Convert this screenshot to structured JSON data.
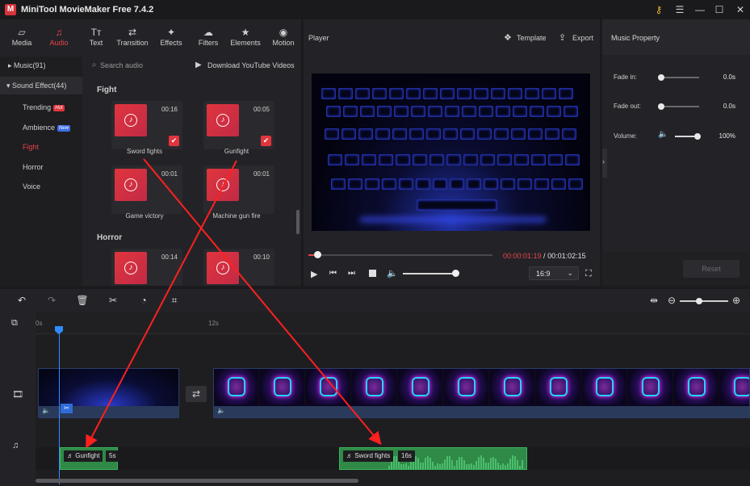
{
  "app": {
    "title": "MiniTool MovieMaker Free 7.4.2",
    "logo_text": "M"
  },
  "window_controls": {
    "key": "⚷",
    "menu": "☰",
    "minimize": "—",
    "maximize": "☐",
    "close": "✕"
  },
  "tabs": [
    {
      "label": "Media",
      "icon": "▱"
    },
    {
      "label": "Audio",
      "icon": "♫"
    },
    {
      "label": "Text",
      "icon": "Tт"
    },
    {
      "label": "Transition",
      "icon": "⇄"
    },
    {
      "label": "Effects",
      "icon": "✦"
    },
    {
      "label": "Filters",
      "icon": "☁"
    },
    {
      "label": "Elements",
      "icon": "★"
    },
    {
      "label": "Motion",
      "icon": "◉"
    }
  ],
  "categories": {
    "music": "Music(91)",
    "sound_effect": "Sound Effect(44)",
    "items": [
      {
        "label": "Trending",
        "badge": "Hot"
      },
      {
        "label": "Ambience",
        "badge": "New"
      },
      {
        "label": "Fight",
        "badge": ""
      },
      {
        "label": "Horror",
        "badge": ""
      },
      {
        "label": "Voice",
        "badge": ""
      }
    ]
  },
  "library": {
    "search_placeholder": "Search audio",
    "download_label": "Download YouTube Videos",
    "fight_title": "Fight",
    "horror_title": "Horror",
    "fight_items": [
      {
        "name": "Sword fights",
        "duration": "00:16"
      },
      {
        "name": "Gunfight",
        "duration": "00:05"
      },
      {
        "name": "Game victory",
        "duration": "00:01"
      },
      {
        "name": "Machine gun fire",
        "duration": "00:01"
      }
    ],
    "horror_items": [
      {
        "duration": "00:14"
      },
      {
        "duration": "00:10"
      }
    ]
  },
  "player": {
    "title": "Player",
    "template_label": "Template",
    "export_label": "Export",
    "time_current": "00:00:01:19",
    "time_separator": " / ",
    "time_total": "00:01:02:15",
    "aspect": "16:9",
    "progress_fraction": 0.05,
    "volume_fraction": 1.0
  },
  "music_property": {
    "title": "Music Property",
    "fade_in_label": "Fade in:",
    "fade_in_value": "0.0s",
    "fade_out_label": "Fade out:",
    "fade_out_value": "0.0s",
    "volume_label": "Volume:",
    "volume_value": "100%",
    "reset_label": "Reset"
  },
  "timeline": {
    "ruler_start": "0s",
    "ruler_mark": "12s",
    "audio_clips": [
      {
        "name": "Gunfight",
        "length": "5s"
      },
      {
        "name": "Sword fights",
        "length": "16s"
      }
    ]
  },
  "colors": {
    "accent": "#e8434a",
    "audio_clip": "#2e8a46",
    "arrow": "#ff2020"
  }
}
